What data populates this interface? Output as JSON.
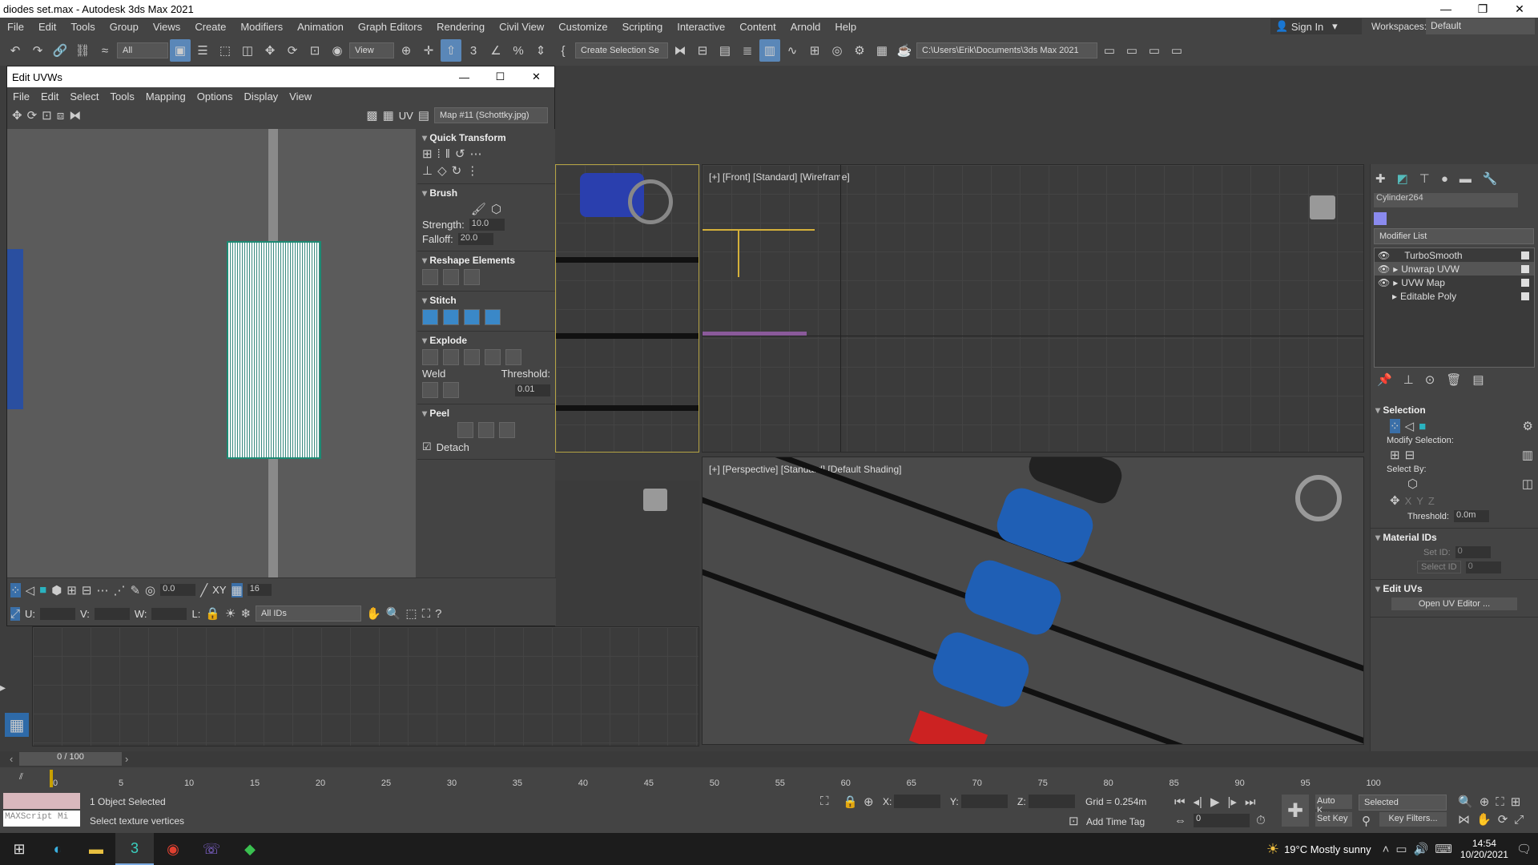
{
  "window": {
    "title": "diodes set.max - Autodesk 3ds Max 2021"
  },
  "menu": [
    "File",
    "Edit",
    "Tools",
    "Group",
    "Views",
    "Create",
    "Modifiers",
    "Animation",
    "Graph Editors",
    "Rendering",
    "Civil View",
    "Customize",
    "Scripting",
    "Interactive",
    "Content",
    "Arnold",
    "Help"
  ],
  "signin": "Sign In",
  "workspaces": {
    "label": "Workspaces:",
    "value": "Default"
  },
  "toolbar": {
    "filter": "All",
    "view": "View",
    "selection_set": "Create Selection Se",
    "path": "C:\\Users\\Erik\\Documents\\3ds Max 2021"
  },
  "uvw": {
    "title": "Edit UVWs",
    "menu": [
      "File",
      "Edit",
      "Select",
      "Tools",
      "Mapping",
      "Options",
      "Display",
      "View"
    ],
    "uv_label": "UV",
    "map": "Map #11 (Schottky.jpg)",
    "sections": {
      "quick": "Quick Transform",
      "brush": "Brush",
      "strength_label": "Strength:",
      "strength": "10.0",
      "falloff_label": "Falloff:",
      "falloff": "20.0",
      "reshape": "Reshape Elements",
      "stitch": "Stitch",
      "explode": "Explode",
      "weld": "Weld",
      "threshold_label": "Threshold:",
      "threshold": "0.01",
      "peel": "Peel",
      "detach": "Detach"
    },
    "bottom": {
      "spin": "0.0",
      "xy": "XY",
      "num": "16",
      "u": "U:",
      "v": "V:",
      "w": "W:",
      "l": "L:",
      "ids": "All IDs"
    }
  },
  "viewports": {
    "front": "[+] [Front] [Standard] [Wireframe]",
    "persp": "[+] [Perspective] [Standard] [Default Shading]"
  },
  "command": {
    "object": "Cylinder264",
    "modlist": "Modifier List",
    "stack": [
      "TurboSmooth",
      "Unwrap UVW",
      "UVW Map",
      "Editable Poly"
    ],
    "selection": "Selection",
    "modify_selection": "Modify Selection:",
    "select_by": "Select By:",
    "threshold_label": "Threshold:",
    "threshold": "0.0m",
    "material_ids": "Material IDs",
    "set_id": "Set ID:",
    "set_id_val": "0",
    "select_id": "Select ID",
    "select_id_val": "0",
    "edit_uvs": "Edit UVs",
    "open_uv": "Open UV Editor ..."
  },
  "time": {
    "frame": "0 / 100",
    "ticks": [
      "0",
      "5",
      "10",
      "15",
      "20",
      "25",
      "30",
      "35",
      "40",
      "45",
      "50",
      "55",
      "60",
      "65",
      "70",
      "75",
      "80",
      "85",
      "90",
      "95",
      "100"
    ]
  },
  "status": {
    "selected": "1 Object Selected",
    "prompt": "Select texture vertices",
    "maxscript": "MAXScript Mi",
    "x": "X:",
    "y": "Y:",
    "z": "Z:",
    "grid": "Grid = 0.254m",
    "add_tag": "Add Time Tag",
    "autokey": "Auto K...",
    "setkey": "Set Key",
    "selected_dd": "Selected",
    "keyfilters": "Key Filters...",
    "frame_val": "0"
  },
  "taskbar": {
    "weather": "19°C  Mostly sunny",
    "time": "14:54",
    "date": "10/20/2021"
  }
}
